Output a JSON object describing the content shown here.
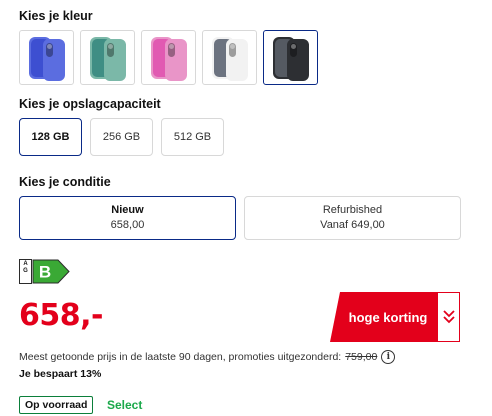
{
  "color_section": {
    "label": "Kies je kleur",
    "swatches": [
      {
        "name": "ultramarine",
        "body": "#5b6de0",
        "screen": "#3d4fd1",
        "selected": false
      },
      {
        "name": "teal",
        "body": "#7bb8a8",
        "screen": "#3f8e84",
        "selected": false
      },
      {
        "name": "pink",
        "body": "#e995c8",
        "screen": "#e15ab2",
        "selected": false
      },
      {
        "name": "white",
        "body": "#f2f2f2",
        "screen": "#6c7380",
        "selected": false
      },
      {
        "name": "black",
        "body": "#2d2f33",
        "screen": "#555a62",
        "selected": true
      }
    ]
  },
  "storage_section": {
    "label": "Kies je opslagcapaciteit",
    "options": [
      "128 GB",
      "256 GB",
      "512 GB"
    ],
    "selected_index": 0
  },
  "condition_section": {
    "label": "Kies je conditie",
    "options": [
      {
        "title": "Nieuw",
        "price": "658,00"
      },
      {
        "title": "Refurbished",
        "price": "Vanaf 649,00"
      }
    ]
  },
  "energy_label": {
    "scale_text": "A\nG",
    "grade": "B",
    "grade_color": "#3aa935"
  },
  "price": {
    "value": "658,-",
    "color": "#e3001b"
  },
  "deal_badge": {
    "label": "hoge korting"
  },
  "price_note": {
    "text": "Meest getoonde prijs in de laatste 90 dagen, promoties uitgezonderd:",
    "old_price": "759,00"
  },
  "savings": "Je bespaart 13%",
  "stock": {
    "badge": "Op voorraad",
    "select_label": "Select",
    "select_color": "#1aa84a"
  }
}
